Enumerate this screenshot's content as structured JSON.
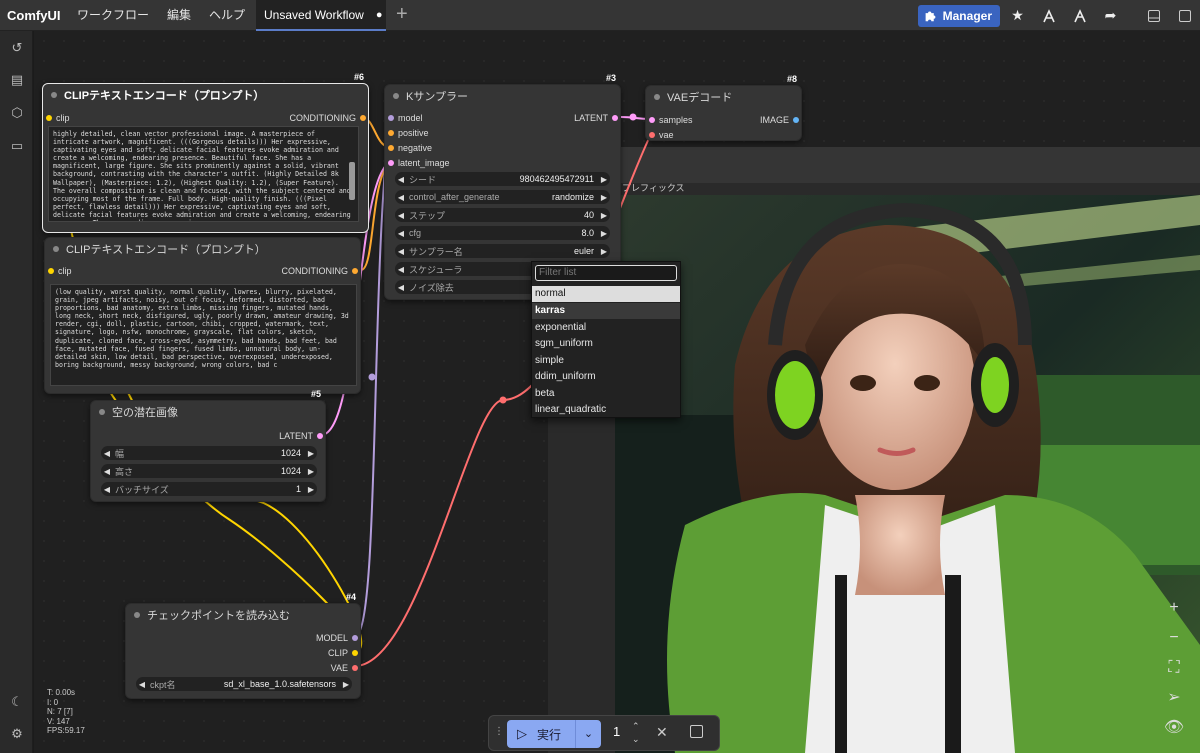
{
  "app": {
    "name": "ComfyUI"
  },
  "menu": [
    "ワークフロー",
    "編集",
    "ヘルプ"
  ],
  "tab": {
    "title": "Unsaved Workflow",
    "modified_dot": "●"
  },
  "toolbar": {
    "manager_label": "Manager"
  },
  "nodes": {
    "clip_pos": {
      "id": "#6",
      "title": "CLIPテキストエンコード（プロンプト）",
      "input": "clip",
      "output": "CONDITIONING",
      "text": "highly detailed, clean vector professional image. A masterpiece of intricate artwork, magnificent. (((Gorgeous details))) Her expressive, captivating eyes and soft, delicate facial features evoke admiration and create a welcoming, endearing presence. Beautiful face. She has a magnificent, large figure. She sits prominently against a solid, vibrant background, contrasting with the character's outfit. (Highly Detailed 8k Wallpaper), (Masterpiece: 1.2), (Highest Quality: 1.2), (Super Feature). The overall composition is clean and focused, with the subject centered and occupying most of the frame. Full body. High-quality finish. (((Pixel perfect, flawless detail))) Her expressive, captivating eyes and soft, delicate facial features evoke admiration and create a welcoming, endearing presence. The surrounding scenery is gorgeous. gorgeous."
    },
    "clip_neg": {
      "id": "#7",
      "title": "CLIPテキストエンコード（プロンプト）",
      "input": "clip",
      "output": "CONDITIONING",
      "text": "(low quality, worst quality, normal quality, lowres, blurry, pixelated, grain, jpeg artifacts, noisy, out of focus, deformed, distorted, bad proportions, bad anatomy, extra limbs, missing fingers, mutated hands, long neck, short neck, disfigured, ugly, poorly drawn, amateur drawing, 3d render, cgi, doll, plastic, cartoon, chibi, cropped, watermark, text, signature, logo, nsfw, monochrome, grayscale, flat colors, sketch, duplicate, cloned face, cross-eyed, asymmetry, bad hands, bad feet, bad face, mutated face, fused fingers, fused limbs, unnatural body, un-detailed skin, low detail, bad perspective, overexposed, underexposed, boring background, messy background, wrong colors, bad c"
    },
    "ksampler": {
      "id": "#3",
      "title": "Kサンプラー",
      "inputs": [
        "model",
        "positive",
        "negative",
        "latent_image"
      ],
      "output": "LATENT",
      "widgets": [
        {
          "label": "シード",
          "value": "980462495472911"
        },
        {
          "label": "control_after_generate",
          "value": "randomize"
        },
        {
          "label": "ステップ",
          "value": "40"
        },
        {
          "label": "cfg",
          "value": "8.0"
        },
        {
          "label": "サンプラー名",
          "value": "euler"
        },
        {
          "label": "スケジューラ",
          "value": ""
        },
        {
          "label": "ノイズ除去",
          "value": ""
        }
      ]
    },
    "vae": {
      "id": "#8",
      "title": "VAEデコード",
      "inputs": [
        "samples",
        "vae"
      ],
      "output": "IMAGE"
    },
    "latent": {
      "id": "#5",
      "title": "空の潜在画像",
      "output": "LATENT",
      "widgets": [
        {
          "label": "幅",
          "value": "1024"
        },
        {
          "label": "高さ",
          "value": "1024"
        },
        {
          "label": "バッチサイズ",
          "value": "1"
        }
      ]
    },
    "checkpoint": {
      "id": "#4",
      "title": "チェックポイントを読み込む",
      "outputs": [
        "MODEL",
        "CLIP",
        "VAE"
      ],
      "widget": {
        "label": "ckpt名",
        "value": "sd_xl_base_1.0.safetensors"
      }
    }
  },
  "preview": {
    "label": "プレフィックス"
  },
  "dropdown": {
    "placeholder": "Filter list",
    "items": [
      "normal",
      "karras",
      "exponential",
      "sgm_uniform",
      "simple",
      "ddim_uniform",
      "beta",
      "linear_quadratic"
    ],
    "selected": "normal",
    "hovered": "karras"
  },
  "runbar": {
    "run_label": "実行",
    "count": "1"
  },
  "stats": {
    "t": "T: 0.00s",
    "i": "I: 0",
    "n": "N: 7 [7]",
    "v": "V: 147",
    "fps": "FPS:59.17"
  },
  "colors": {
    "accent": "#3a64c0",
    "run": "#8aa8f2",
    "model": "#b39ddb",
    "clip": "#ffd500",
    "vae": "#ff6e6e",
    "latent": "#ff9cf9",
    "conditioning": "#ffa931",
    "image": "#64b5f6"
  }
}
